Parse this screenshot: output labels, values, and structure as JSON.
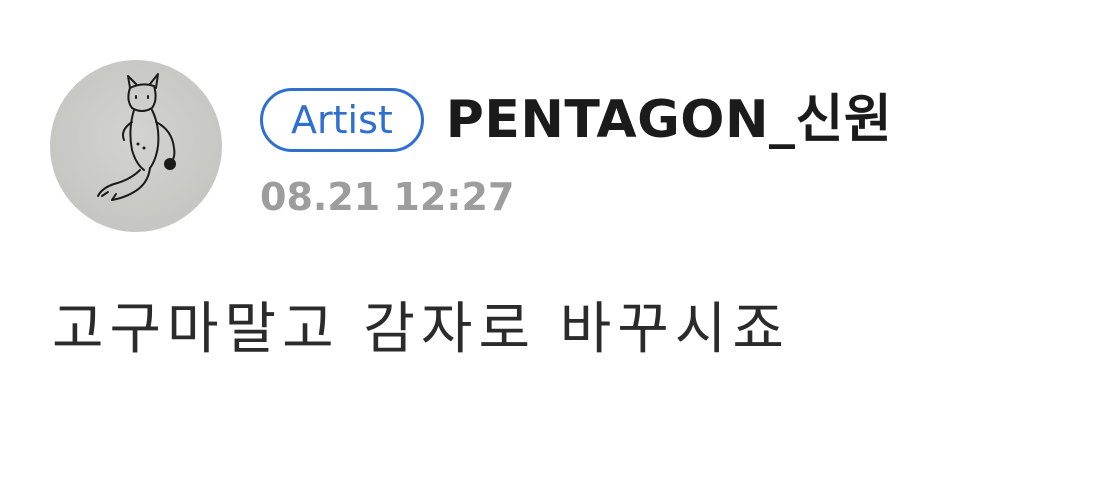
{
  "post": {
    "author": {
      "badge": "Artist",
      "name": "PENTAGON_신원",
      "avatar_icon": "doodle-character-avatar"
    },
    "timestamp": "08.21 12:27",
    "content": "고구마말고 감자로 바꾸시죠"
  },
  "colors": {
    "badge_accent": "#2f6fd0",
    "name_text": "#1b1b1b",
    "timestamp_text": "#9d9d9d",
    "body_text": "#2b2b2b",
    "background": "#ffffff"
  }
}
